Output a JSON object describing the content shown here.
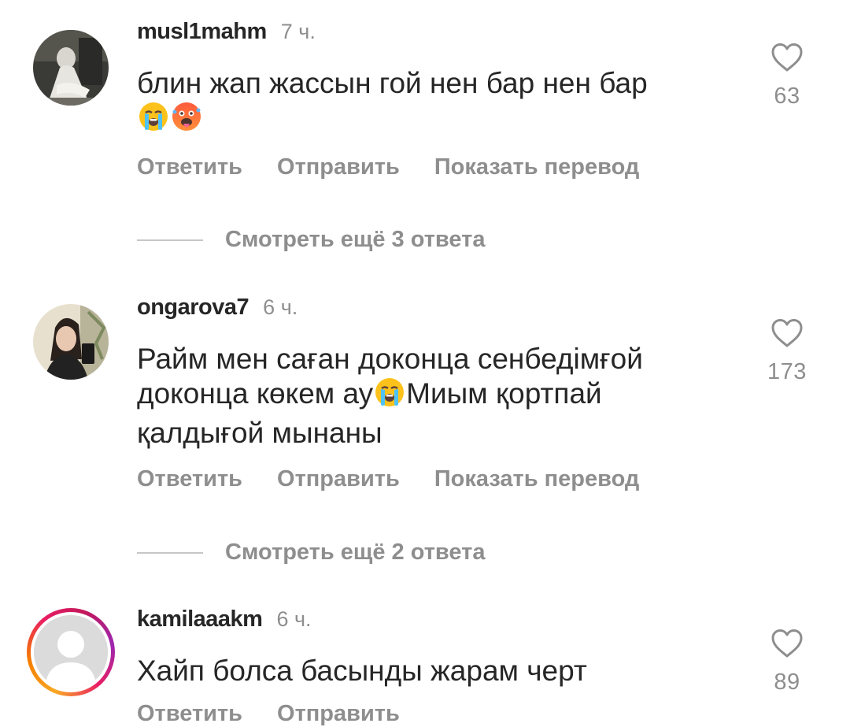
{
  "comments": [
    {
      "username": "musl1mahm",
      "time": "7 ч.",
      "text": "блин жап жассын гой нен бар нен бар",
      "text_after": "",
      "text_tail": "",
      "likes": "63",
      "actions": {
        "reply": "Ответить",
        "send": "Отправить",
        "translate": "Показать перевод"
      },
      "view_replies": "Смотреть ещё 3 ответа"
    },
    {
      "username": "ongarova7",
      "time": "6 ч.",
      "text": "Райм мен саған доконца сенбедімғой доконца көкем ау",
      "text_after": "Миым қортпай қалдығой мынаны",
      "likes": "173",
      "actions": {
        "reply": "Ответить",
        "send": "Отправить",
        "translate": "Показать перевод"
      },
      "view_replies": "Смотреть ещё 2 ответа"
    },
    {
      "username": "kamilaaakm",
      "time": "6 ч.",
      "text": "Хайп болса басынды жарам черт",
      "likes": "89",
      "actions": {
        "reply": "Ответить",
        "send": "Отправить"
      }
    }
  ],
  "icons": {
    "like": "heart-outline-icon",
    "emoji_crying": "loudly-crying-face-emoji",
    "emoji_hot": "hot-face-emoji",
    "default_avatar": "default-user-avatar-icon"
  },
  "colors": {
    "text_primary": "#262626",
    "text_secondary": "#8e8e8e",
    "divider": "#c7c7c7",
    "story_ring_start": "#f9a825",
    "story_ring_end": "#9c27b0"
  }
}
